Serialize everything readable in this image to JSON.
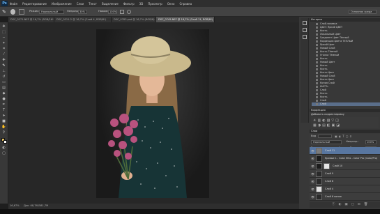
{
  "app": {
    "logo": "Ps"
  },
  "menu": [
    "Файл",
    "Редактирование",
    "Изображение",
    "Слои",
    "Текст",
    "Выделение",
    "Фильтр",
    "3D",
    "Просмотр",
    "Окно",
    "Справка"
  ],
  "options_bar": {
    "mode_label": "Режим:",
    "mode_value": "Нормальный",
    "opacity_label": "Непрозр.:",
    "opacity_value": "30%",
    "flow_label": "Нажим:",
    "flow_value": "100%"
  },
  "workspace": {
    "value": "Основная среда"
  },
  "tabs": [
    {
      "label": "DSC_0271.NEF @ 16,7% (RGB/16*)"
    },
    {
      "label": "DSC_0211-2 @ 16,7% (Слой 4, RGB/8*)"
    },
    {
      "label": "DSC_0783.psd @ 16,7% (RGB/8)"
    },
    {
      "label": "DSC_0745.NEF @ 16,7% (Слой 11, RGB/8*)"
    }
  ],
  "status": {
    "zoom": "16,67%",
    "doc": "Док: 68,7M/581,7M"
  },
  "history": {
    "title": "История",
    "items": [
      "Слой-заливка",
      "Цвет: Яркий ЦВЕТ",
      "Кисть",
      "Локальный Цвет",
      "Градиент Цвет Тёплый",
      "Коррекция Цвета ТЁПЛЫЙ",
      "Яркий Цвет",
      "Новый Слой",
      "Кисть Тёмный",
      "Уголки Тёмный",
      "Кисть",
      "Новый Цвет",
      "Кисть",
      "Кисть",
      "Кисть Цвет",
      "Новый Слой",
      "Кисть Цвет",
      "Копия Слой",
      "КИСТЬ",
      "Слой",
      "Кисть",
      "Кисть",
      "Слой",
      "Слой"
    ]
  },
  "adjustments": {
    "title": "Коррекция",
    "subtitle": "Добавить корректировку"
  },
  "layers": {
    "title": "Слои",
    "filter_label": "Вид",
    "blend_mode": "Нормальный",
    "opacity_label": "Непрозр.:",
    "opacity_value": "100%",
    "lock_label": "Закрепить:",
    "fill_label": "Заливка:",
    "fill_value": "100%",
    "items": [
      {
        "name": "Слой 11",
        "selected": true
      },
      {
        "name": "Кривые 1 - Color Efex - Color Pro (Color/Pro)",
        "selected": false
      },
      {
        "name": "Слой 10",
        "selected": false
      },
      {
        "name": "Слой 9",
        "selected": false
      },
      {
        "name": "Слой 8",
        "selected": false
      },
      {
        "name": "Слой 4",
        "selected": false
      },
      {
        "name": "Слой 6 копия",
        "selected": false
      }
    ]
  }
}
